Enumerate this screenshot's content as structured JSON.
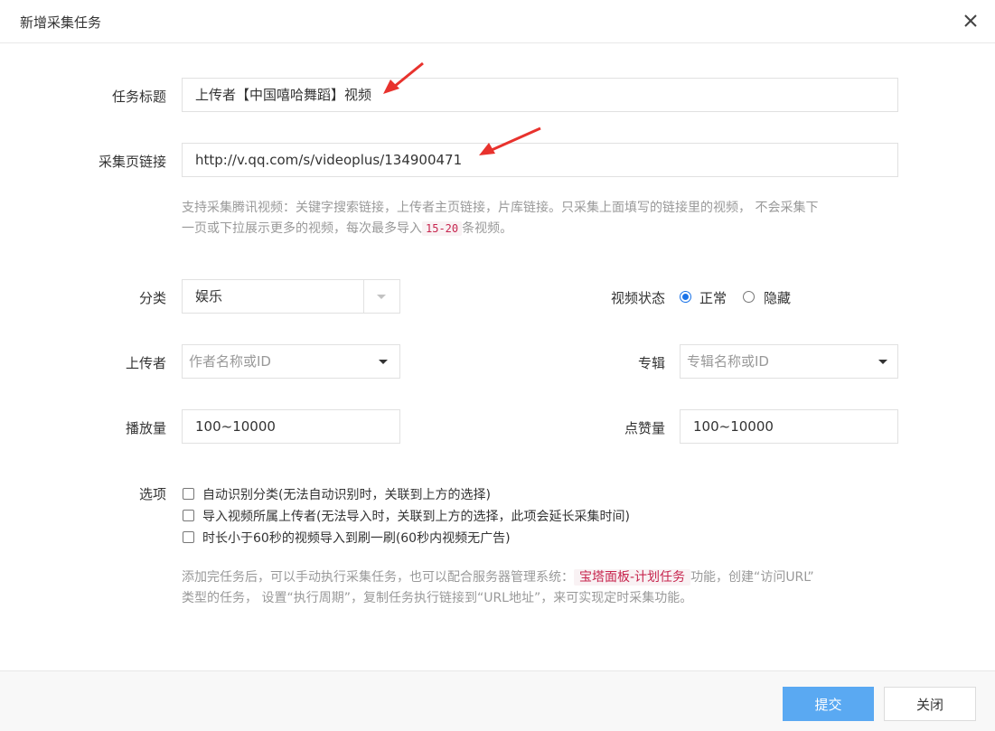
{
  "dialog": {
    "title": "新增采集任务",
    "close_icon": "close-icon"
  },
  "form": {
    "task_title": {
      "label": "任务标题",
      "value": "上传者【中国嘻哈舞蹈】视频"
    },
    "collect_url": {
      "label": "采集页链接",
      "value": "http://v.qq.com/s/videoplus/134900471"
    },
    "url_hint": {
      "part1": "支持采集腾讯视频：关键字搜索链接，上传者主页链接，片库链接。只采集上面填写的链接里的视频， 不会采集下",
      "part2": "一页或下拉展示更多的视频，每次最多导入",
      "code": "15-20",
      "part3": "条视频。"
    },
    "category": {
      "label": "分类",
      "value": "娱乐"
    },
    "video_status": {
      "label": "视频状态",
      "options": [
        {
          "label": "正常",
          "checked": true
        },
        {
          "label": "隐藏",
          "checked": false
        }
      ]
    },
    "uploader": {
      "label": "上传者",
      "placeholder": "作者名称或ID"
    },
    "album": {
      "label": "专辑",
      "placeholder": "专辑名称或ID"
    },
    "play_count": {
      "label": "播放量",
      "value": "100~10000"
    },
    "like_count": {
      "label": "点赞量",
      "value": "100~10000"
    },
    "options": {
      "label": "选项",
      "items": [
        {
          "label": "自动识别分类(无法自动识别时，关联到上方的选择)",
          "checked": false
        },
        {
          "label": "导入视频所属上传者(无法导入时，关联到上方的选择，此项会延长采集时间)",
          "checked": false
        },
        {
          "label": "时长小于60秒的视频导入到刷一刷(60秒内视频无广告)",
          "checked": false
        }
      ]
    },
    "footer_hint": {
      "part1": "添加完任务后，可以手动执行采集任务，也可以配合服务器管理系统：",
      "tag": "宝塔面板-计划任务",
      "part2": "功能，创建“访问URL”",
      "part3": "类型的任务， 设置“执行周期”，复制任务执行链接到“URL地址”，来可实现定时采集功能。"
    }
  },
  "footer": {
    "submit_label": "提交",
    "close_label": "关闭"
  },
  "colors": {
    "primary": "#5aa9f2",
    "annotation_arrow": "#e8322d",
    "radio_checked": "#1a73e8"
  }
}
